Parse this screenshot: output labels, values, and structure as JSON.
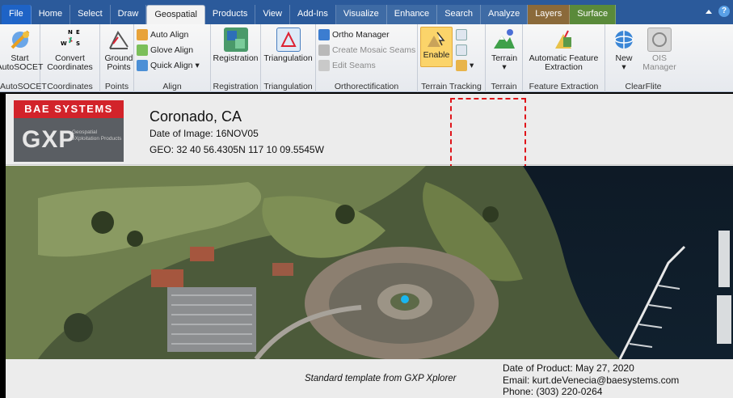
{
  "tabs": [
    {
      "label": "File",
      "kind": "file"
    },
    {
      "label": "Home"
    },
    {
      "label": "Select"
    },
    {
      "label": "Draw"
    },
    {
      "label": "Geospatial",
      "kind": "active"
    },
    {
      "label": "Products"
    },
    {
      "label": "View"
    },
    {
      "label": "Add-Ins"
    },
    {
      "label": "Visualize",
      "kind": "ctx-vis"
    },
    {
      "label": "Enhance",
      "kind": "ctx-vis"
    },
    {
      "label": "Search",
      "kind": "ctx-vis"
    },
    {
      "label": "Analyze",
      "kind": "ctx-vis"
    },
    {
      "label": "Layers",
      "kind": "ctx-layers"
    },
    {
      "label": "Surface",
      "kind": "ctx-surf"
    }
  ],
  "help_label": "?",
  "ribbon": {
    "start_autosocet": "Start AutoSOCET",
    "group_autosocet": "AutoSOCET",
    "convert_coordinates": "Convert Coordinates",
    "group_coordinates": "Coordinates",
    "ground_points": "Ground Points",
    "group_points": "Points",
    "auto_align": "Auto Align",
    "glove_align": "Glove Align",
    "quick_align": "Quick Align",
    "group_align": "Align",
    "registration": "Registration",
    "group_registration": "Registration",
    "triangulation": "Triangulation",
    "group_triangulation": "Triangulation",
    "ortho_manager": "Ortho Manager",
    "create_mosaic_seams": "Create Mosaic Seams",
    "edit_seams": "Edit Seams",
    "group_ortho": "Orthorectification",
    "enable": "Enable",
    "group_terrain_tracking": "Terrain Tracking",
    "terrain": "Terrain",
    "group_terrain": "Terrain",
    "automatic_feature_extraction": "Automatic Feature Extraction",
    "group_feature_extraction": "Feature Extraction",
    "new": "New",
    "ois_manager": "OIS Manager",
    "group_clearflite": "ClearFlite"
  },
  "logo": {
    "top": "BAE SYSTEMS",
    "gxp": "GXP",
    "sub": "Geospatial eXploitation Products"
  },
  "header": {
    "place": "Coronado, CA",
    "date_of_image": "Date of Image: 16NOV05",
    "geo": "GEO: 32 40 56.4305N 117 10 09.5545W"
  },
  "footer": {
    "template_note": "Standard template from GXP Xplorer",
    "date_of_product": "Date of Product: May 27, 2020",
    "email": "Email: kurt.deVenecia@baesystems.com",
    "phone": "Phone: (303) 220-0264"
  }
}
